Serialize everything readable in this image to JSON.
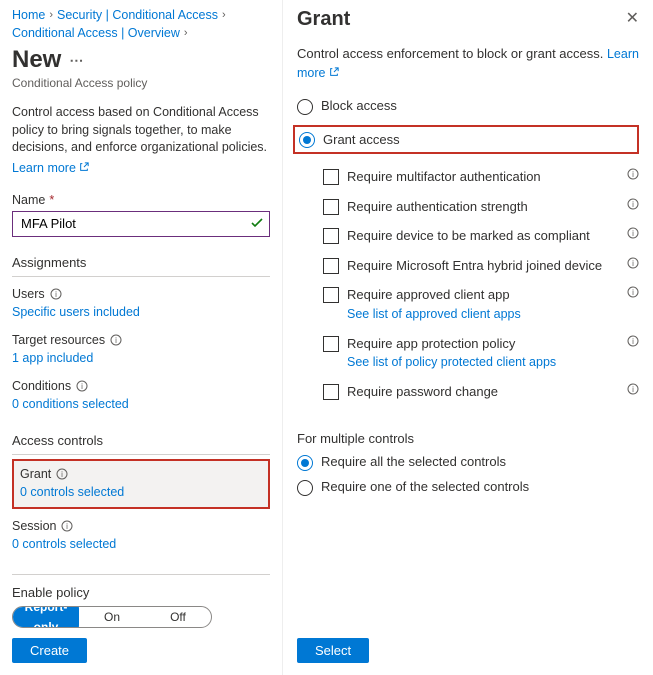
{
  "breadcrumb": {
    "items": [
      {
        "label": "Home"
      },
      {
        "label": "Security | Conditional Access"
      },
      {
        "label": "Conditional Access | Overview"
      }
    ]
  },
  "left": {
    "title": "New",
    "subtitle": "Conditional Access policy",
    "description": "Control access based on Conditional Access policy to bring signals together, to make decisions, and enforce organizational policies.",
    "learn_more": "Learn more",
    "name_label": "Name",
    "name_value": "MFA Pilot",
    "assignments_header": "Assignments",
    "users_label": "Users",
    "users_value": "Specific users included",
    "target_label": "Target resources",
    "target_value": "1 app included",
    "conditions_label": "Conditions",
    "conditions_value": "0 conditions selected",
    "access_controls_header": "Access controls",
    "grant_label": "Grant",
    "grant_value": "0 controls selected",
    "session_label": "Session",
    "session_value": "0 controls selected",
    "enable_label": "Enable policy",
    "toggle": {
      "report": "Report-only",
      "on": "On",
      "off": "Off"
    },
    "create_btn": "Create"
  },
  "right": {
    "title": "Grant",
    "description_prefix": "Control access enforcement to block or grant access. ",
    "learn_more": "Learn more",
    "block_label": "Block access",
    "grant_label": "Grant access",
    "checks": [
      {
        "label": "Require multifactor authentication",
        "info": true
      },
      {
        "label": "Require authentication strength",
        "info": true
      },
      {
        "label": "Require device to be marked as compliant",
        "info": true
      },
      {
        "label": "Require Microsoft Entra hybrid joined device",
        "info": true
      },
      {
        "label": "Require approved client app",
        "info": true,
        "link": "See list of approved client apps"
      },
      {
        "label": "Require app protection policy",
        "info": true,
        "link": "See list of policy protected client apps"
      },
      {
        "label": "Require password change",
        "info": true
      }
    ],
    "multi_header": "For multiple controls",
    "multi_all": "Require all the selected controls",
    "multi_one": "Require one of the selected controls",
    "select_btn": "Select"
  }
}
